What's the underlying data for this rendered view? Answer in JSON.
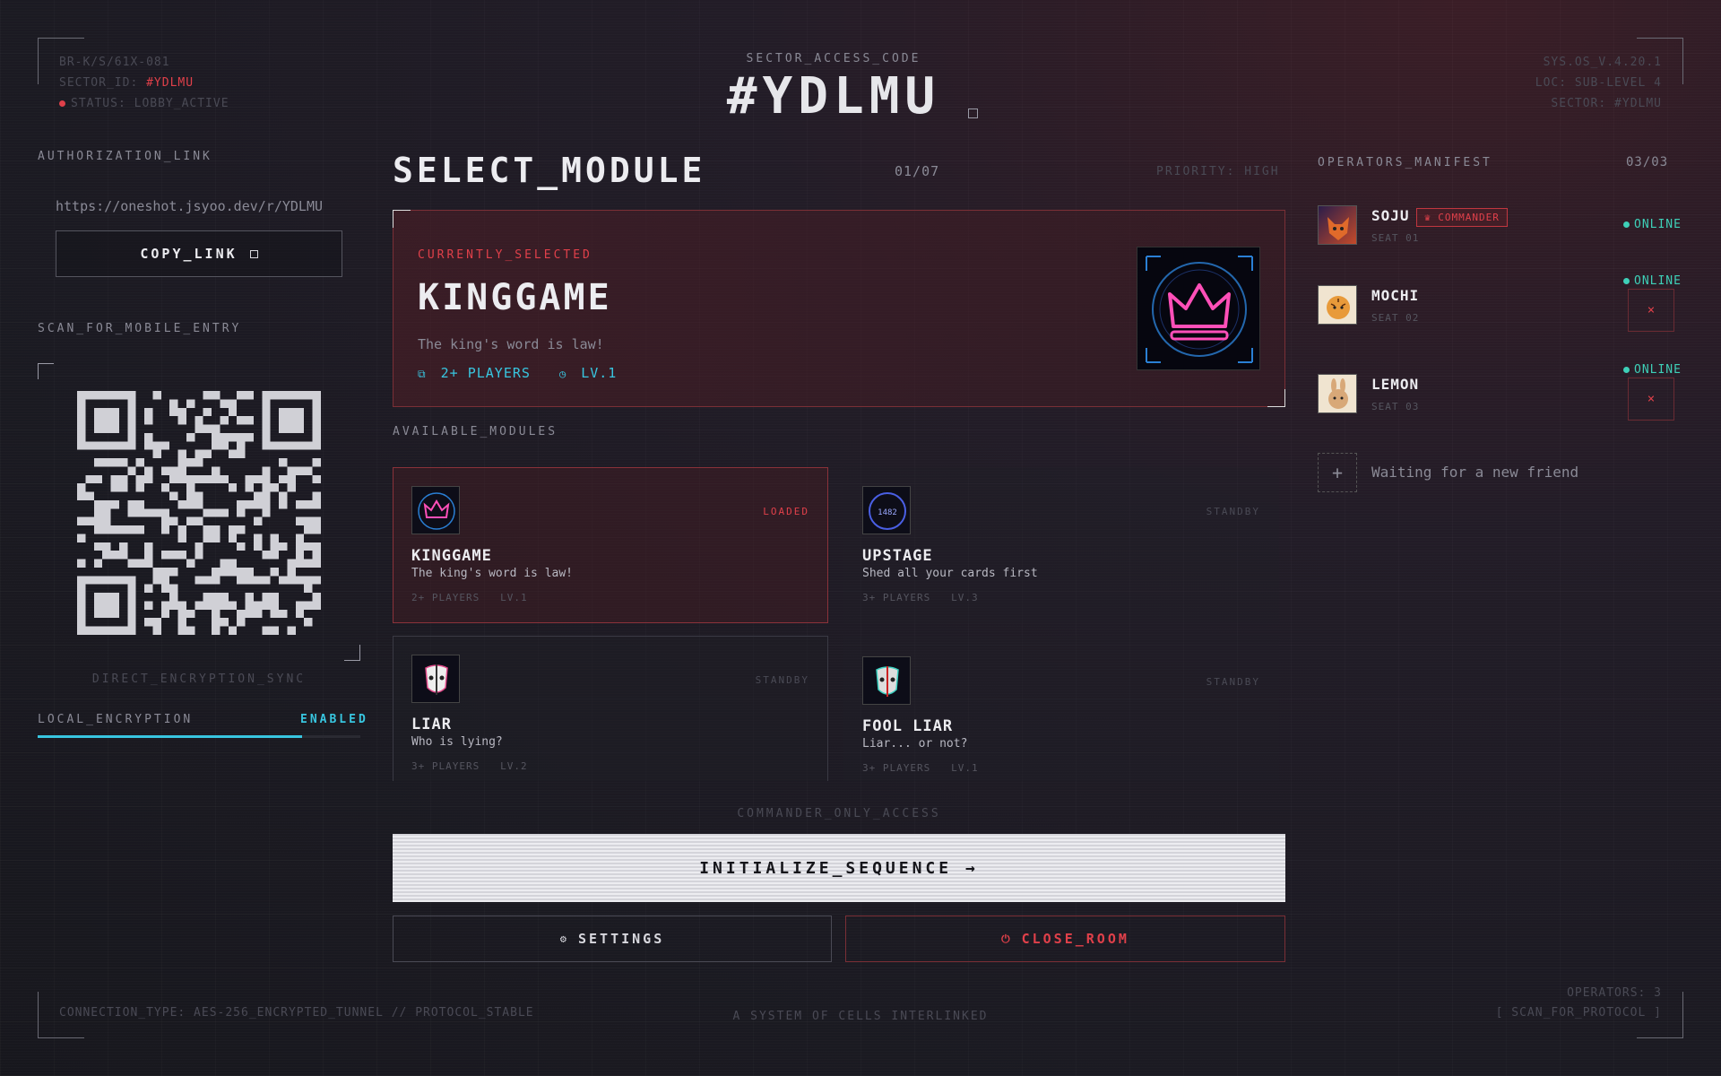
{
  "header": {
    "left": {
      "line1": "BR-K/S/61X-081",
      "sector_label": "SECTOR_ID:",
      "sector_value": "#YDLMU",
      "status": "STATUS: LOBBY_ACTIVE"
    },
    "center": {
      "label": "SECTOR_ACCESS_CODE",
      "code": "#YDLMU",
      "copy_icon": "copy-icon"
    },
    "right": {
      "line1": "SYS.OS_V.4.20.1",
      "line2": "LOC: SUB-LEVEL 4",
      "line3": "SECTOR: #YDLMU"
    }
  },
  "left": {
    "auth_label": "AUTHORIZATION_LINK",
    "auth_url": "https://oneshot.jsyoo.dev/r/YDLMU",
    "copy_button": "COPY_LINK",
    "scan_label": "SCAN_FOR_MOBILE_ENTRY",
    "sync_label": "DIRECT_ENCRYPTION_SYNC",
    "encryption_label": "LOCAL_ENCRYPTION",
    "encryption_status": "ENABLED"
  },
  "main": {
    "title": "SELECT_MODULE",
    "page_counter": "01/07",
    "priority": "PRIORITY: HIGH",
    "selected": {
      "tag": "CURRENTLY_SELECTED",
      "name": "KINGGAME",
      "desc": "The king's word is law!",
      "players": "2+ PLAYERS",
      "level": "LV.1"
    },
    "available_label": "AVAILABLE_MODULES",
    "modules": [
      {
        "name": "KINGGAME",
        "desc": "The king's word is law!",
        "players": "2+ PLAYERS",
        "level": "LV.1",
        "status": "LOADED"
      },
      {
        "name": "UPSTAGE",
        "desc": "Shed all your cards first",
        "players": "3+ PLAYERS",
        "level": "LV.3",
        "status": "STANDBY"
      },
      {
        "name": "LIAR",
        "desc": "Who is lying?",
        "players": "3+ PLAYERS",
        "level": "LV.2",
        "status": "STANDBY"
      },
      {
        "name": "FOOL LIAR",
        "desc": "Liar... or not?",
        "players": "3+ PLAYERS",
        "level": "LV.1",
        "status": "STANDBY"
      }
    ],
    "commander_label": "COMMANDER_ONLY_ACCESS",
    "init_button": "INITIALIZE_SEQUENCE →",
    "settings_button": "SETTINGS",
    "close_button": "CLOSE_ROOM"
  },
  "operators": {
    "label": "OPERATORS_MANIFEST",
    "count": "03/03",
    "list": [
      {
        "name": "SOJU",
        "seat": "SEAT 01",
        "status": "ONLINE",
        "badge": "COMMANDER"
      },
      {
        "name": "MOCHI",
        "seat": "SEAT 02",
        "status": "ONLINE",
        "kick": "×"
      },
      {
        "name": "LEMON",
        "seat": "SEAT 03",
        "status": "ONLINE",
        "kick": "×"
      }
    ],
    "waiting": "Waiting for a new friend",
    "add_icon": "+"
  },
  "footer": {
    "left": "CONNECTION_TYPE: AES-256_ENCRYPTED_TUNNEL // PROTOCOL_STABLE",
    "center": "A SYSTEM OF CELLS INTERLINKED",
    "right1": "OPERATORS: 3",
    "right2": "[ SCAN_FOR_PROTOCOL ]"
  },
  "colors": {
    "accent_red": "#e0404a",
    "accent_cyan": "#38c6e0",
    "online_teal": "#3ed0b8"
  }
}
